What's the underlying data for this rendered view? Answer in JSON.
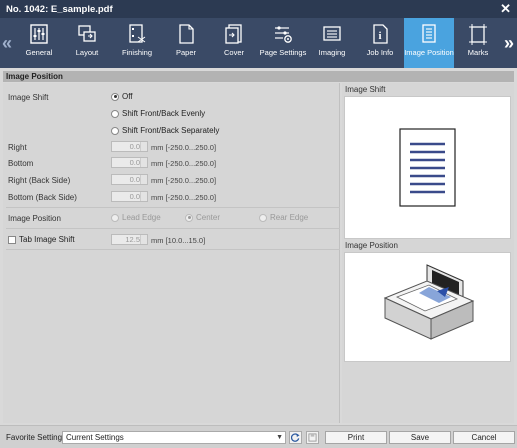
{
  "window": {
    "title": "No. 1042: E_sample.pdf"
  },
  "toolbar": {
    "items": [
      {
        "label": "General",
        "icon": "sliders-icon"
      },
      {
        "label": "Layout",
        "icon": "layout-icon"
      },
      {
        "label": "Finishing",
        "icon": "finishing-icon"
      },
      {
        "label": "Paper",
        "icon": "paper-icon"
      },
      {
        "label": "Cover",
        "icon": "cover-icon"
      },
      {
        "label": "Page Settings",
        "icon": "page-settings-icon"
      },
      {
        "label": "Imaging",
        "icon": "imaging-icon"
      },
      {
        "label": "Job Info",
        "icon": "job-info-icon"
      },
      {
        "label": "Image Position",
        "icon": "image-position-icon"
      },
      {
        "label": "Marks",
        "icon": "marks-icon"
      }
    ],
    "active_index": 8,
    "active_color": "#4aa3df"
  },
  "section": {
    "title": "Image Position"
  },
  "image_shift": {
    "label": "Image Shift",
    "options": [
      "Off",
      "Shift Front/Back Evenly",
      "Shift Front/Back Separately"
    ],
    "selected": "Off"
  },
  "fields": [
    {
      "label": "Right",
      "value": "0.0",
      "range": "mm [-250.0...250.0]"
    },
    {
      "label": "Bottom",
      "value": "0.0",
      "range": "mm [-250.0...250.0]"
    },
    {
      "label": "Right (Back Side)",
      "value": "0.0",
      "range": "mm [-250.0...250.0]"
    },
    {
      "label": "Bottom (Back Side)",
      "value": "0.0",
      "range": "mm [-250.0...250.0]"
    }
  ],
  "image_position": {
    "label": "Image Position",
    "options": [
      "Lead Edge",
      "Center",
      "Rear Edge"
    ],
    "selected": "Center"
  },
  "tab_shift": {
    "label": "Tab Image Shift",
    "value": "12.5",
    "range": "mm [10.0...15.0]"
  },
  "previews": {
    "image_shift_title": "Image Shift",
    "image_position_title": "Image Position"
  },
  "bottom": {
    "favorite_label": "Favorite Setting",
    "favorite_value": "Current Settings",
    "print_label": "Print",
    "save_label": "Save",
    "cancel_label": "Cancel"
  }
}
